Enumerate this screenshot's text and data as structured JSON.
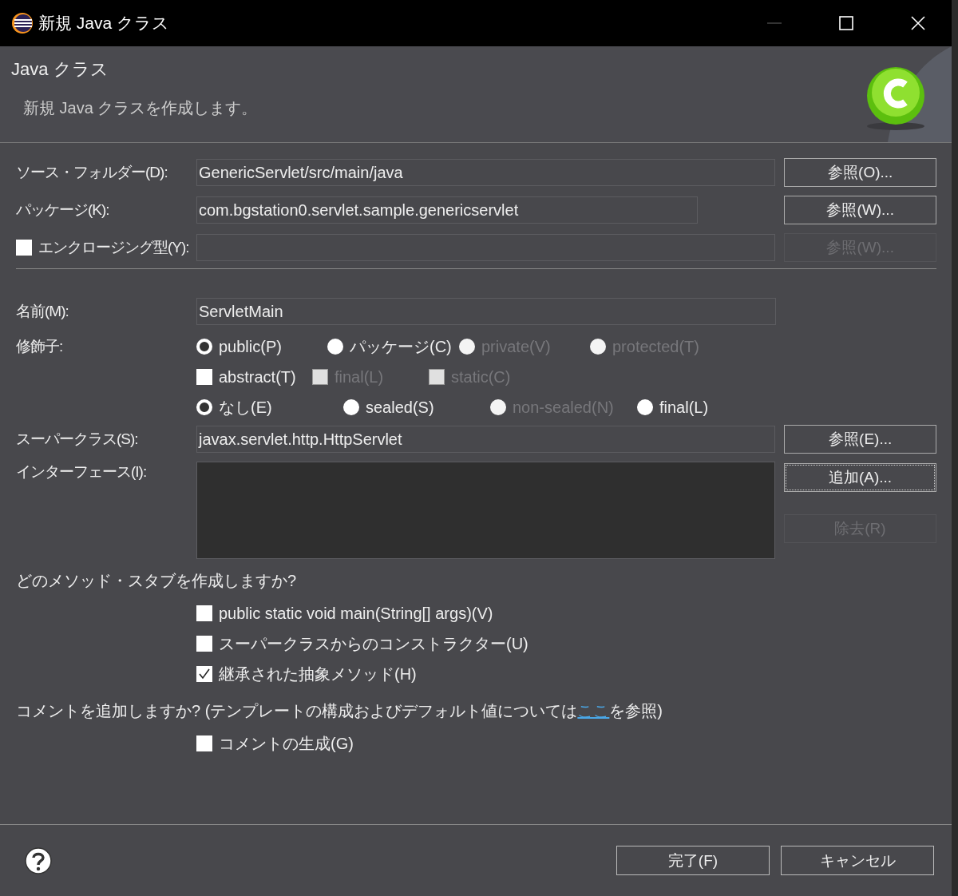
{
  "window": {
    "title": "新規 Java クラス"
  },
  "header": {
    "title": "Java クラス",
    "description": "新規 Java クラスを作成します。"
  },
  "top_fields": [
    {
      "kind": "text",
      "label": "ソース・フォルダー(D):",
      "value": "GenericServlet/src/main/java",
      "button": {
        "label": "参照(O)...",
        "disabled": false
      }
    },
    {
      "kind": "text",
      "label": "パッケージ(K):",
      "value": "com.bgstation0.servlet.sample.genericservlet",
      "button": {
        "label": "参照(W)...",
        "disabled": false
      }
    },
    {
      "kind": "checkbox",
      "label": "エンクロージング型(Y):",
      "checked": false,
      "button": {
        "label": "参照(W)...",
        "disabled": true
      }
    }
  ],
  "name": {
    "label": "名前(M):",
    "value": "ServletMain"
  },
  "modifiers": {
    "label": "修飾子:",
    "rows": [
      [
        {
          "kind": "radio",
          "label": "public(P)",
          "selected": true,
          "disabled": false
        },
        {
          "kind": "radio",
          "label": "パッケージ(C)",
          "selected": false,
          "disabled": false
        },
        {
          "kind": "radio",
          "label": "private(V)",
          "selected": false,
          "disabled": true
        },
        {
          "kind": "radio",
          "label": "protected(T)",
          "selected": false,
          "disabled": true
        }
      ],
      [
        {
          "kind": "checkbox",
          "label": "abstract(T)",
          "checked": false,
          "disabled": false
        },
        {
          "kind": "checkbox",
          "label": "final(L)",
          "checked": false,
          "disabled": true
        },
        {
          "kind": "checkbox",
          "label": "static(C)",
          "checked": false,
          "disabled": true
        }
      ],
      [
        {
          "kind": "radio",
          "label": "なし(E)",
          "selected": true,
          "disabled": false
        },
        {
          "kind": "radio",
          "label": "sealed(S)",
          "selected": false,
          "disabled": false
        },
        {
          "kind": "radio",
          "label": "non-sealed(N)",
          "selected": false,
          "disabled": true
        },
        {
          "kind": "radio",
          "label": "final(L)",
          "selected": false,
          "disabled": false
        }
      ]
    ]
  },
  "superclass": {
    "label": "スーパークラス(S):",
    "value": "javax.servlet.http.HttpServlet",
    "button": {
      "label": "参照(E)...",
      "disabled": false
    }
  },
  "interfaces": {
    "label": "インターフェース(I):",
    "buttons": [
      {
        "label": "追加(A)...",
        "disabled": false,
        "focused": true
      },
      {
        "label": "除去(R)",
        "disabled": true,
        "focused": false
      }
    ]
  },
  "stubs": {
    "question": "どのメソッド・スタブを作成しますか?",
    "options": [
      {
        "label": "public static void main(String[] args)(V)",
        "checked": false
      },
      {
        "label": "スーパークラスからのコンストラクター(U)",
        "checked": false
      },
      {
        "label": "継承された抽象メソッド(H)",
        "checked": true
      }
    ]
  },
  "comments": {
    "question_before": "コメントを追加しますか? (テンプレートの構成およびデフォルト値については",
    "link": "ここ",
    "question_after": "を参照)",
    "options": [
      {
        "label": "コメントの生成(G)",
        "checked": false
      }
    ]
  },
  "footer": {
    "buttons": [
      {
        "label": "完了(F)"
      },
      {
        "label": "キャンセル"
      }
    ]
  }
}
